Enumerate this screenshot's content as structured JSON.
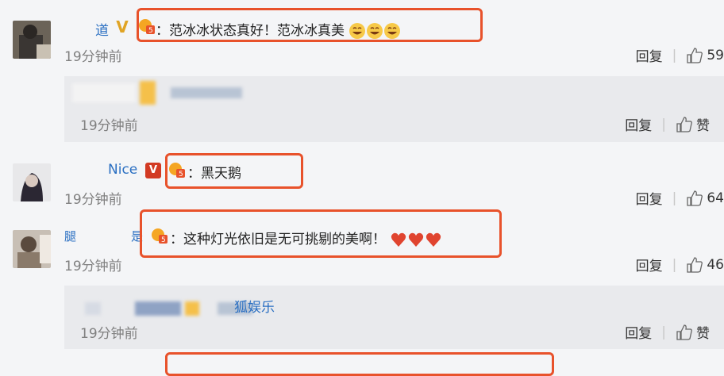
{
  "comments": [
    {
      "name": "道",
      "text": "：范冰冰状态真好！范冰冰真美",
      "time": "19分钟前",
      "reply_label": "回复",
      "likes": "59"
    },
    {
      "time": "19分钟前",
      "reply_label": "回复",
      "like_label": "赞"
    },
    {
      "name": "Nice",
      "text": "：黑天鹅",
      "time": "19分钟前",
      "reply_label": "回复",
      "likes": "64"
    },
    {
      "name_fragment": "腿",
      "name_end": "是",
      "text": "：这种灯光依旧是无可挑剔的美啊！",
      "time": "19分钟前",
      "reply_label": "回复",
      "likes": "46"
    },
    {
      "source": "狐娱乐",
      "time": "19分钟前",
      "reply_label": "回复",
      "like_label": "赞"
    }
  ],
  "colors": {
    "highlight": "#e8522b",
    "link": "#2a6fc2",
    "time": "#808080"
  }
}
